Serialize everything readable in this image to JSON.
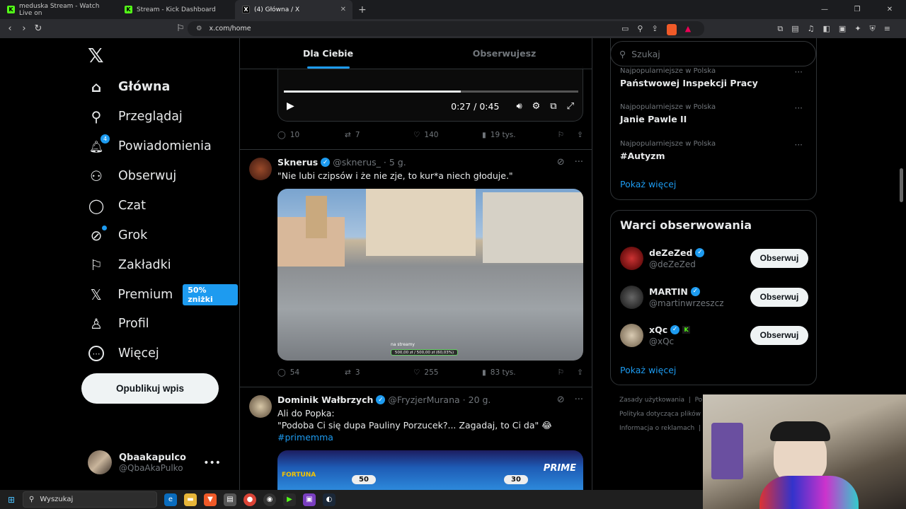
{
  "browser": {
    "tabs": [
      {
        "title": "meduska Stream - Watch Live on",
        "icon": "kick-icon"
      },
      {
        "title": "Stream - Kick Dashboard",
        "icon": "kick-icon"
      },
      {
        "title": "(4) Główna / X",
        "icon": "x-icon"
      }
    ],
    "url": "x.com/home"
  },
  "sidebar": {
    "items": [
      {
        "label": "Główna",
        "icon": "home-icon",
        "glyph": "⌂"
      },
      {
        "label": "Przeglądaj",
        "icon": "search-icon",
        "glyph": "⚲"
      },
      {
        "label": "Powiadomienia",
        "icon": "bell-icon",
        "glyph": "🔔︎"
      },
      {
        "label": "Obserwuj",
        "icon": "add-user-icon",
        "glyph": "⚇"
      },
      {
        "label": "Czat",
        "icon": "chat-icon",
        "glyph": "◯"
      },
      {
        "label": "Grok",
        "icon": "grok-icon",
        "glyph": "⊘"
      },
      {
        "label": "Zakładki",
        "icon": "bookmark-icon",
        "glyph": "⚐"
      },
      {
        "label": "Premium",
        "icon": "x-logo-icon",
        "glyph": "𝕏"
      },
      {
        "label": "Profil",
        "icon": "profile-icon",
        "glyph": "♙"
      },
      {
        "label": "Więcej",
        "icon": "more-icon",
        "glyph": "⋯"
      }
    ],
    "notification_count": "4",
    "premium_badge": "50% zniżki",
    "post_button": "Opublikuj wpis",
    "user": {
      "name": "Qbaakapulco",
      "handle": "@QbaAkaPulko"
    }
  },
  "feed": {
    "tabs": [
      "Dla Ciebie",
      "Obserwujesz"
    ],
    "video": {
      "time": "0:27 / 0:45",
      "progress": 0.6
    },
    "tweet0_actions": {
      "replies": "10",
      "reposts": "7",
      "likes": "140",
      "views": "19 tys."
    },
    "tweet1": {
      "name": "Sknerus",
      "handle": "@sknerus_",
      "time": "· 5 g.",
      "text": "\"Nie lubi czipsów i że nie zje, to kur*a niech głoduje.\"",
      "overlay_caption": "na streamy",
      "overlay_bar": "500,00 zł / 500,00 zł (60,03%)",
      "replies": "54",
      "reposts": "3",
      "likes": "255",
      "views": "83 tys."
    },
    "tweet2": {
      "name": "Dominik Wałbrzych",
      "handle": "@FryzjerMurana",
      "time": "· 20 g.",
      "line1": "Ali do Popka:",
      "line2": "\"Podoba Ci się dupa Pauliny Porzucek?... Zagadaj, to Ci da\" 😂",
      "hashtag": "#primemma",
      "media_left": "50",
      "media_right": "30",
      "media_brand": "PRIME",
      "media_sponsor": "FORTUNA"
    }
  },
  "right": {
    "search_placeholder": "Szukaj",
    "trends": [
      {
        "context": "Najpopularniejsze w Polska",
        "title": "Państwowej Inspekcji Pracy"
      },
      {
        "context": "Najpopularniejsze w Polska",
        "title": "Janie Pawle II"
      },
      {
        "context": "Najpopularniejsze w Polska",
        "title": "#Autyzm"
      }
    ],
    "show_more": "Pokaż więcej",
    "who_to_follow_title": "Warci obserwowania",
    "suggestions": [
      {
        "name": "deZeZed",
        "handle": "@deZeZed",
        "button": "Obserwuj"
      },
      {
        "name": "MARTIN",
        "handle": "@martinwrzeszcz",
        "button": "Obserwuj"
      },
      {
        "name": "xQc",
        "handle": "@xQc",
        "button": "Obserwuj"
      }
    ],
    "show_more2": "Pokaż więcej",
    "footer": [
      "Zasady użytkowania",
      "|",
      "Po",
      "Polityka dotycząca plików c",
      "Informacja o reklamach",
      "|"
    ]
  },
  "taskbar": {
    "search": "Wyszukaj"
  }
}
